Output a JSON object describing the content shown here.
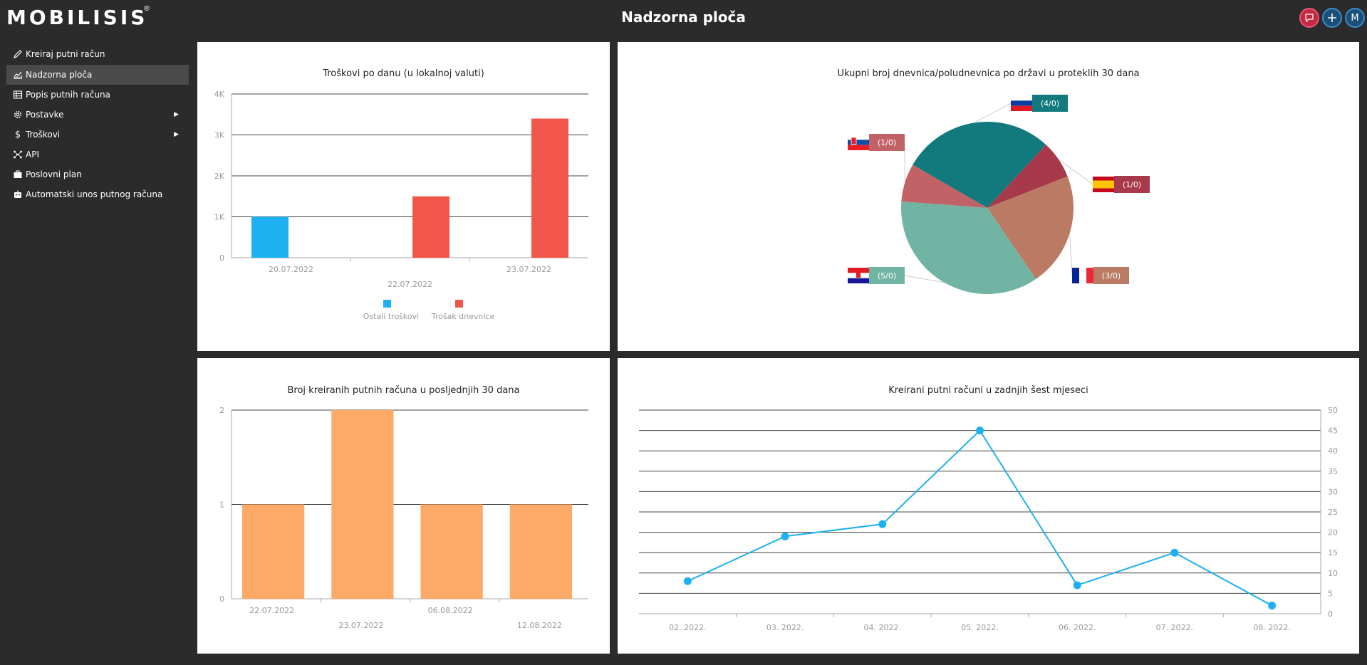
{
  "app": {
    "logo": "MOBILISIS",
    "logo_mark": "®",
    "page_title": "Nadzorna ploča"
  },
  "topbar": {
    "user_initial": "M"
  },
  "sidebar": {
    "items": [
      {
        "label": "Kreiraj putni račun",
        "icon": "pencil-icon"
      },
      {
        "label": "Nadzorna ploča",
        "icon": "chart-icon",
        "active": true
      },
      {
        "label": "Popis putnih računa",
        "icon": "table-icon"
      },
      {
        "label": "Postavke",
        "icon": "gear-icon",
        "submenu": true
      },
      {
        "label": "Troškovi",
        "icon": "dollar-icon",
        "submenu": true
      },
      {
        "label": "API",
        "icon": "api-icon"
      },
      {
        "label": "Poslovni plan",
        "icon": "briefcase-icon"
      },
      {
        "label": "Automatski unos putnog računa",
        "icon": "robot-icon"
      }
    ]
  },
  "colors": {
    "blue": "#1eb0f0",
    "red": "#f2564b",
    "orange": "#fdaa68",
    "line": "#1eb0f0"
  },
  "chart_data": [
    {
      "type": "bar",
      "title": "Troškovi po danu (u lokalnoj valuti)",
      "categories": [
        "20.07.2022",
        "22.07.2022",
        "23.07.2022"
      ],
      "series": [
        {
          "name": "Ostali troškovi",
          "values": [
            1000,
            0,
            0
          ]
        },
        {
          "name": "Trošak dnevnice",
          "values": [
            0,
            1500,
            3400
          ]
        }
      ],
      "ylim": [
        0,
        4000
      ],
      "y_ticks": [
        "0",
        "1K",
        "2K",
        "3K",
        "4K"
      ],
      "legend": "bottom"
    },
    {
      "type": "pie",
      "title": "Ukupni broj dnevnica/poludnevnica po državi u proteklih 30 dana",
      "slices": [
        {
          "country": "Slovenia",
          "label": "(4/0)",
          "value": 4,
          "color": "#12797d"
        },
        {
          "country": "Spain",
          "label": "(1/0)",
          "value": 1,
          "color": "#a8394a"
        },
        {
          "country": "France",
          "label": "(3/0)",
          "value": 3,
          "color": "#bb7a64"
        },
        {
          "country": "Croatia",
          "label": "(5/0)",
          "value": 5,
          "color": "#72b4a3"
        },
        {
          "country": "Slovakia",
          "label": "(1/0)",
          "value": 1,
          "color": "#c16267"
        }
      ]
    },
    {
      "type": "bar",
      "title": "Broj kreiranih putnih računa u posljednjih 30 dana",
      "categories": [
        "22.07.2022",
        "23.07.2022",
        "06.08.2022",
        "12.08.2022"
      ],
      "values": [
        1,
        2,
        1,
        1
      ],
      "ylim": [
        0,
        2
      ],
      "y_ticks": [
        "0",
        "1",
        "2"
      ]
    },
    {
      "type": "line",
      "title": "Kreirani putni računi u zadnjih šest mjeseci",
      "categories": [
        "02. 2022.",
        "03. 2022.",
        "04. 2022.",
        "05. 2022.",
        "06. 2022.",
        "07. 2022.",
        "08. 2022."
      ],
      "values": [
        8,
        19,
        22,
        45,
        7,
        15,
        2
      ],
      "ylim": [
        0,
        50
      ],
      "y_ticks": [
        "0",
        "5",
        "10",
        "15",
        "20",
        "25",
        "30",
        "35",
        "40",
        "45",
        "50"
      ],
      "y_axis": "right"
    }
  ]
}
